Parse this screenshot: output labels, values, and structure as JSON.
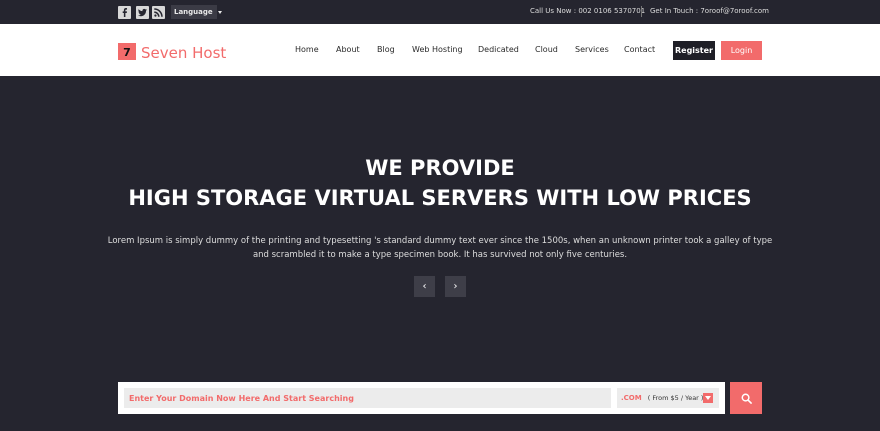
{
  "topbar": {
    "social_icons": [
      "facebook-icon",
      "twitter-icon",
      "rss-icon"
    ],
    "language_label": "Language",
    "call_us": "Call Us Now : 002 0106 5370701",
    "get_in_touch": "Get In Touch : 7oroof@7oroof.com"
  },
  "brand": {
    "logo_mark": "7",
    "name": "Seven Host",
    "accent_color": "#f26b6b"
  },
  "nav": {
    "items": [
      "Home",
      "About",
      "Blog",
      "Web Hosting",
      "Dedicated",
      "Cloud",
      "Services",
      "Contact"
    ],
    "register_label": "Register",
    "login_label": "Login"
  },
  "hero": {
    "title_line1": "WE PROVIDE",
    "title_line2": "HIGH STORAGE VIRTUAL SERVERS WITH LOW PRICES",
    "desc_line1": "Lorem Ipsum is simply dummy of the printing and typesetting 's standard dummy text ever since the 1500s, when an unknown printer took a galley of type",
    "desc_line2": "and scrambled it to make a type specimen book. It has survived not only five centuries.",
    "prev_arrow": "‹",
    "next_arrow": "›"
  },
  "domain_search": {
    "placeholder": "Enter Your Domain Now Here And Start Searching",
    "tld": ".COM",
    "price": "( From $5 / Year )"
  }
}
